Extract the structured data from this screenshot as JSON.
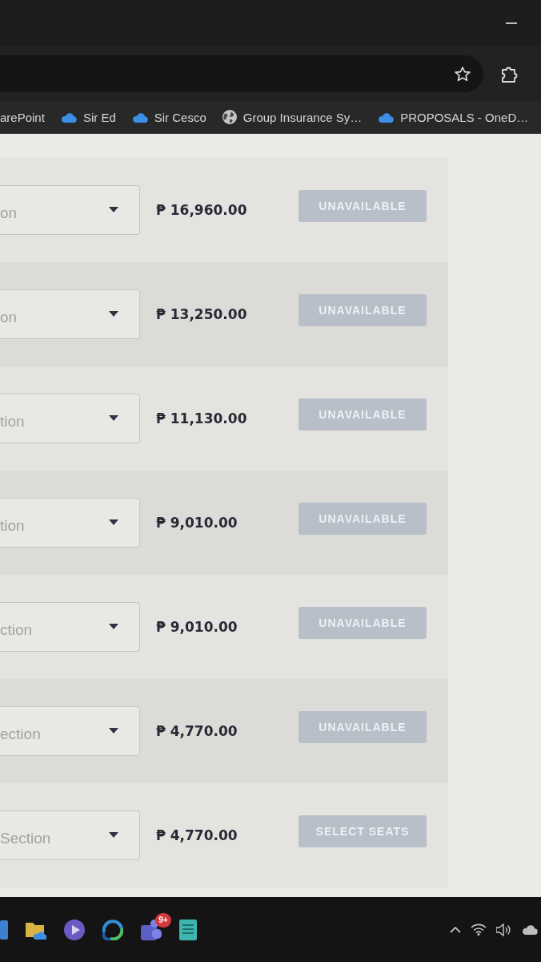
{
  "browser": {
    "bookmarks": [
      {
        "label": "arePoint",
        "kind": "none"
      },
      {
        "label": "Sir Ed",
        "kind": "cloud"
      },
      {
        "label": "Sir Cesco",
        "kind": "cloud"
      },
      {
        "label": "Group Insurance Sy…",
        "kind": "globe"
      },
      {
        "label": "PROPOSALS - OneD…",
        "kind": "cloud"
      }
    ]
  },
  "ticket_rows": [
    {
      "section": {
        "value": "on"
      },
      "price": "₱ 16,960.00",
      "button": {
        "label": "UNAVAILABLE",
        "disabled": true
      }
    },
    {
      "section": {
        "value": "on"
      },
      "price": "₱ 13,250.00",
      "button": {
        "label": "UNAVAILABLE",
        "disabled": true
      }
    },
    {
      "section": {
        "value": "tion"
      },
      "price": "₱ 11,130.00",
      "button": {
        "label": "UNAVAILABLE",
        "disabled": true
      }
    },
    {
      "section": {
        "value": "tion"
      },
      "price": "₱ 9,010.00",
      "button": {
        "label": "UNAVAILABLE",
        "disabled": true
      }
    },
    {
      "section": {
        "value": "ction"
      },
      "price": "₱ 9,010.00",
      "button": {
        "label": "UNAVAILABLE",
        "disabled": true
      }
    },
    {
      "section": {
        "value": "ection"
      },
      "price": "₱ 4,770.00",
      "button": {
        "label": "UNAVAILABLE",
        "disabled": true
      }
    },
    {
      "section": {
        "value": "Section"
      },
      "price": "₱ 4,770.00",
      "button": {
        "label": "SELECT SEATS",
        "disabled": true
      }
    }
  ],
  "taskbar": {
    "badge": "9+"
  }
}
